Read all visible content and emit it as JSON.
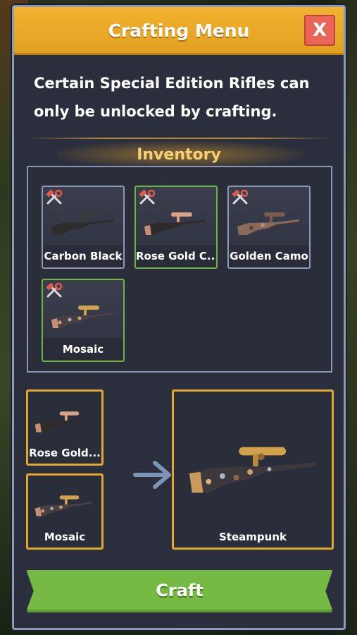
{
  "header": {
    "title": "Crafting Menu",
    "close_label": "X"
  },
  "description": "Certain Special Edition Rifles can only be unlocked by crafting.",
  "inventory": {
    "title": "Inventory",
    "items": [
      {
        "label": "Carbon Black",
        "selected": false,
        "icon": "tools-icon"
      },
      {
        "label": "Rose Gold C...",
        "selected": true,
        "icon": "tools-icon"
      },
      {
        "label": "Golden Camo",
        "selected": false,
        "icon": "tools-icon"
      },
      {
        "label": "Mosaic",
        "selected": true,
        "icon": "tools-icon"
      }
    ]
  },
  "recipe": {
    "inputs": [
      {
        "label": "Rose Gold..."
      },
      {
        "label": "Mosaic"
      }
    ],
    "arrow_icon": "arrow-right-icon",
    "output": {
      "label": "Steampunk"
    }
  },
  "craft_button": {
    "label": "Craft"
  },
  "colors": {
    "header": "#f2b331",
    "close": "#ea6458",
    "panel": "#2b2f3d",
    "selected_border": "#6fb43c",
    "slot_border": "#e2a82e",
    "craft": "#6fb43c"
  }
}
